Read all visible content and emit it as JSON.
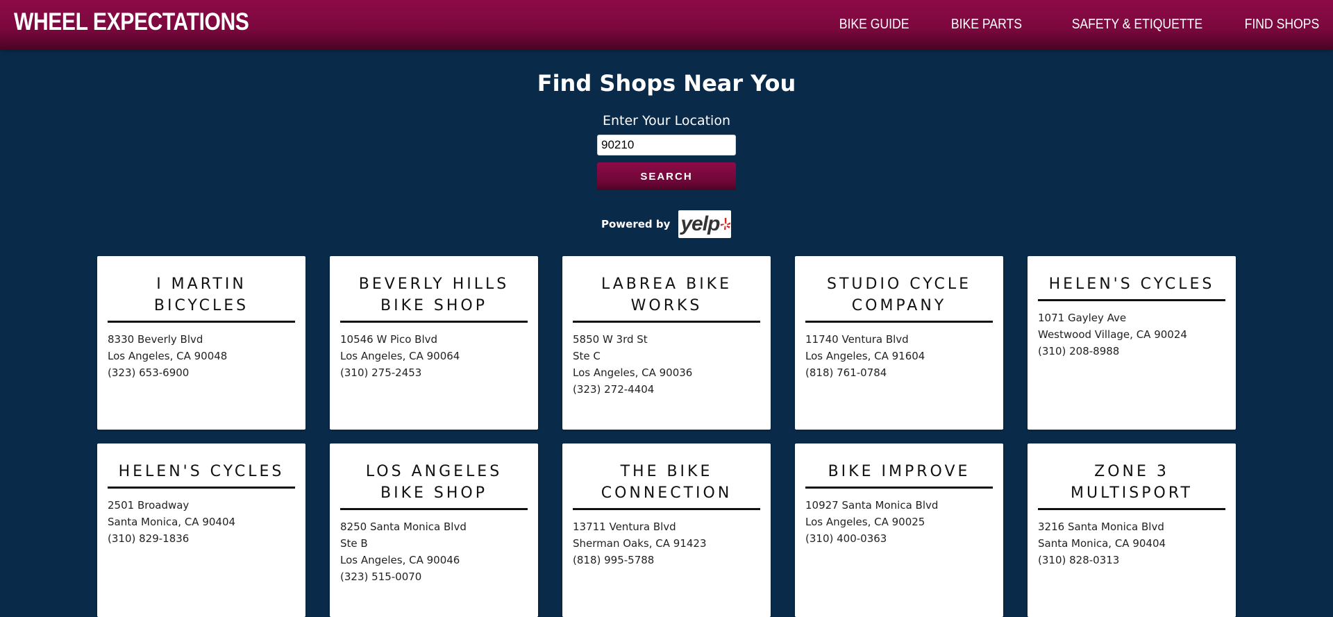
{
  "header": {
    "brand": "WHEEL EXPECTATIONS",
    "nav": [
      "BIKE GUIDE",
      "BIKE PARTS",
      "SAFETY & ETIQUETTE",
      "FIND SHOPS"
    ]
  },
  "search": {
    "title": "Find Shops Near You",
    "label": "Enter Your Location",
    "value": "90210",
    "button": "SEARCH",
    "powered_by": "Powered by",
    "logo_text": "yelp"
  },
  "shops": [
    {
      "name": "I MARTIN BICYCLES",
      "lines": [
        "8330 Beverly Blvd",
        "Los Angeles, CA 90048",
        "(323) 653-6900"
      ]
    },
    {
      "name": "BEVERLY HILLS BIKE SHOP",
      "lines": [
        "10546 W Pico Blvd",
        "Los Angeles, CA 90064",
        "(310) 275-2453"
      ]
    },
    {
      "name": "LABREA BIKE WORKS",
      "lines": [
        "5850 W 3rd St",
        "Ste C",
        "Los Angeles, CA 90036",
        "(323) 272-4404"
      ]
    },
    {
      "name": "STUDIO CYCLE COMPANY",
      "lines": [
        "11740 Ventura Blvd",
        "Los Angeles, CA 91604",
        "(818) 761-0784"
      ]
    },
    {
      "name": "HELEN'S CYCLES",
      "lines": [
        "1071 Gayley Ave",
        "Westwood Village, CA 90024",
        "(310) 208-8988"
      ]
    },
    {
      "name": "HELEN'S CYCLES",
      "lines": [
        "2501 Broadway",
        "Santa Monica, CA 90404",
        "(310) 829-1836"
      ]
    },
    {
      "name": "LOS ANGELES BIKE SHOP",
      "lines": [
        "8250 Santa Monica Blvd",
        "Ste B",
        "Los Angeles, CA 90046",
        "(323) 515-0070"
      ]
    },
    {
      "name": "THE BIKE CONNECTION",
      "lines": [
        "13711 Ventura Blvd",
        "Sherman Oaks, CA 91423",
        "(818) 995-5788"
      ]
    },
    {
      "name": "BIKE IMPROVE",
      "lines": [
        "10927 Santa Monica Blvd",
        "Los Angeles, CA 90025",
        "(310) 400-0363"
      ]
    },
    {
      "name": "ZONE 3 MULTISPORT",
      "lines": [
        "3216 Santa Monica Blvd",
        "Santa Monica, CA 90404",
        "(310) 828-0313"
      ]
    }
  ],
  "colors": {
    "header": "#7a083d",
    "background": "#0a2a4a",
    "card": "#ffffff",
    "yelp_burst": "#d32323"
  }
}
